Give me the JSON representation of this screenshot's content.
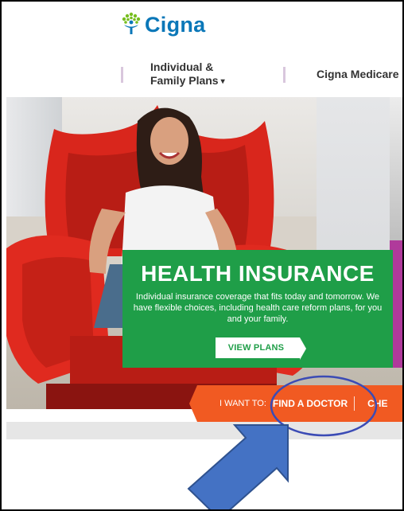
{
  "header": {
    "logo_text": "Cigna",
    "logo_icon": "tree-person-icon"
  },
  "nav": {
    "items": [
      {
        "label_line1": "Individual &",
        "label_line2": "Family Plans",
        "has_dropdown": true
      },
      {
        "label_line1": "Cigna Medicare",
        "label_line2": "",
        "has_dropdown": false
      }
    ]
  },
  "hero": {
    "card": {
      "title": "HEALTH INSURANCE",
      "body": "Individual insurance coverage that fits today and tomorrow. We have flexible choices, including health care reform plans, for you and your family.",
      "button_label": "VIEW PLANS",
      "color": "#1f9e48"
    }
  },
  "want_bar": {
    "label": "I WANT TO:",
    "links": [
      "FIND A DOCTOR",
      "CHE"
    ],
    "color": "#f15a22"
  },
  "annotations": {
    "circle_color": "#3b4bb5",
    "arrow_color": "#4472c4"
  }
}
